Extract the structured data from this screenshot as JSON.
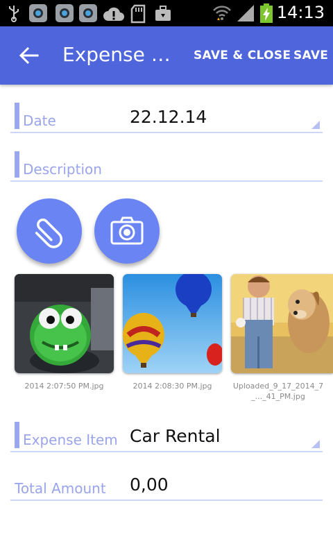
{
  "status_bar": {
    "time": "14:13",
    "icons": [
      "usb-icon",
      "app-icon",
      "app-icon",
      "app-icon",
      "cloud-alert-icon",
      "sd-card-icon",
      "briefcase-icon",
      "wifi-icon",
      "signal-icon",
      "battery-charging-icon"
    ]
  },
  "toolbar": {
    "title": "Expense R...",
    "save_close_label": "SAVE & CLOSE",
    "save_label": "SAVE",
    "back_icon": "arrow-back-icon"
  },
  "form": {
    "date": {
      "label": "Date",
      "value": "22.12.14"
    },
    "description": {
      "label": "Description",
      "value": ""
    },
    "expense_item": {
      "label": "Expense Item",
      "value": "Car Rental"
    },
    "total_amount": {
      "label": "Total Amount",
      "value": "0,00"
    }
  },
  "attachments": {
    "attach_icon": "paperclip-icon",
    "camera_icon": "camera-icon",
    "items": [
      {
        "caption": "2014 2:07:50 PM.jpg"
      },
      {
        "caption": "2014 2:08:30 PM.jpg"
      },
      {
        "caption": "Uploaded_9_17_2014_7_..._41_PM.jpg"
      }
    ]
  },
  "colors": {
    "primary": "#4f65dc",
    "accent_button": "#6a85f3",
    "label": "#9aa4ec",
    "underline": "#cfd6f5"
  }
}
